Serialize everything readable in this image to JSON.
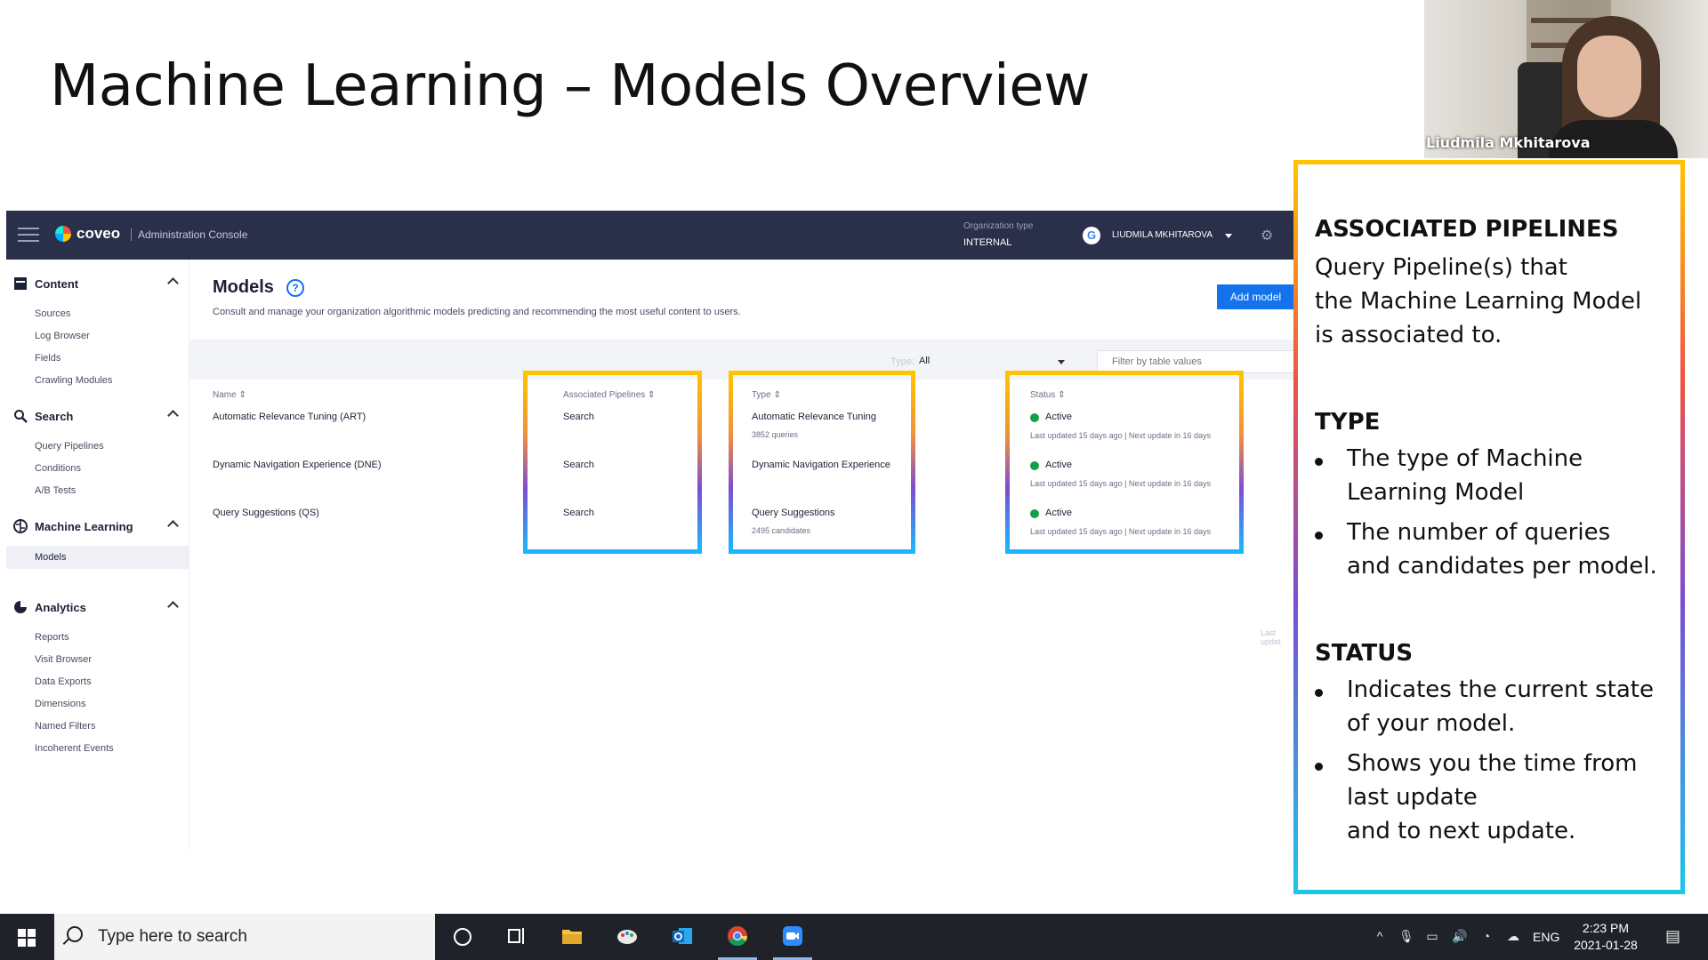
{
  "slide": {
    "title": "Machine Learning – Models Overview"
  },
  "webcam": {
    "presenter_name": "Liudmila Mkhitarova"
  },
  "console": {
    "brand": "coveo",
    "app_name": "Administration Console",
    "org_type_label": "Organization type",
    "org_type_value": "INTERNAL",
    "user_initial": "G",
    "user_name": "LIUDMILA MKHITAROVA",
    "sidebar": {
      "content": {
        "label": "Content",
        "items": [
          "Sources",
          "Log Browser",
          "Fields",
          "Crawling Modules"
        ]
      },
      "search": {
        "label": "Search",
        "items": [
          "Query Pipelines",
          "Conditions",
          "A/B Tests"
        ]
      },
      "ml": {
        "label": "Machine Learning",
        "items": [
          "Models"
        ]
      },
      "analytics": {
        "label": "Analytics",
        "items": [
          "Reports",
          "Visit Browser",
          "Data Exports",
          "Dimensions",
          "Named Filters",
          "Incoherent Events"
        ]
      }
    },
    "page": {
      "title": "Models",
      "help_glyph": "?",
      "description": "Consult and manage your organization algorithmic models predicting and recommending the most useful content to users.",
      "add_button": "Add model",
      "type_filter_label": "Type:",
      "type_filter_value": "All",
      "filter_placeholder": "Filter by table values",
      "columns": [
        "Name ⇕",
        "Associated Pipelines ⇕",
        "Type ⇕",
        "Status ⇕"
      ],
      "rows": [
        {
          "name": "Automatic Relevance Tuning (ART)",
          "pipeline": "Search",
          "type": "Automatic Relevance Tuning",
          "type_sub": "3852 queries",
          "status": "Active",
          "updated": "Last updated 15 days ago  |  Next update in 16 days"
        },
        {
          "name": "Dynamic Navigation Experience (DNE)",
          "pipeline": "Search",
          "type": "Dynamic Navigation Experience",
          "type_sub": "",
          "status": "Active",
          "updated": "Last updated 15 days ago  |  Next update in 16 days"
        },
        {
          "name": "Query Suggestions (QS)",
          "pipeline": "Search",
          "type": "Query Suggestions",
          "type_sub": "2495 candidates",
          "status": "Active",
          "updated": "Last updated 15 days ago  |  Next update in 16 days"
        }
      ],
      "last_updated_cut": "Last updat"
    }
  },
  "info_panel": {
    "pipelines_heading": "ASSOCIATED PIPELINES",
    "pipelines_text": [
      "Query Pipeline(s) that",
      "the Machine Learning Model",
      "is associated to."
    ],
    "type_heading": "TYPE",
    "type_bullets": [
      [
        "The type of Machine",
        "Learning Model"
      ],
      [
        "The number of queries",
        "and candidates per model."
      ]
    ],
    "status_heading": "STATUS",
    "status_bullets": [
      [
        "Indicates the current state",
        "of your model."
      ],
      [
        "Shows you the time from",
        "last update",
        "and to next update."
      ]
    ]
  },
  "taskbar": {
    "search_placeholder": "Type here to search",
    "language": "ENG",
    "time": "2:23 PM",
    "date": "2021-01-28"
  },
  "colors": {
    "topbar": "#2a2f4a",
    "accent": "#1372ec",
    "active_dot": "#12a244"
  }
}
